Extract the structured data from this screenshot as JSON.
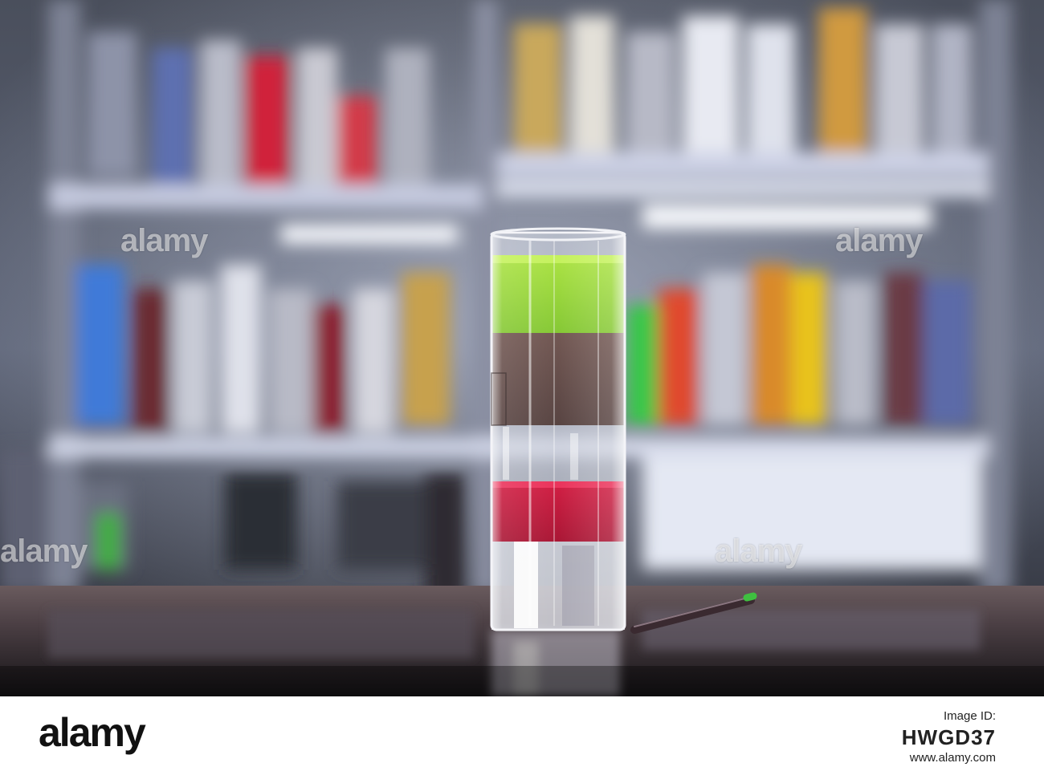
{
  "photo": {
    "description_icon": "layered-shot-glass-photo",
    "watermark_text": "alamy"
  },
  "footer": {
    "brand": "alamy",
    "label": "Image ID:",
    "image_id": "HWGD37",
    "site": "www.alamy.com"
  }
}
